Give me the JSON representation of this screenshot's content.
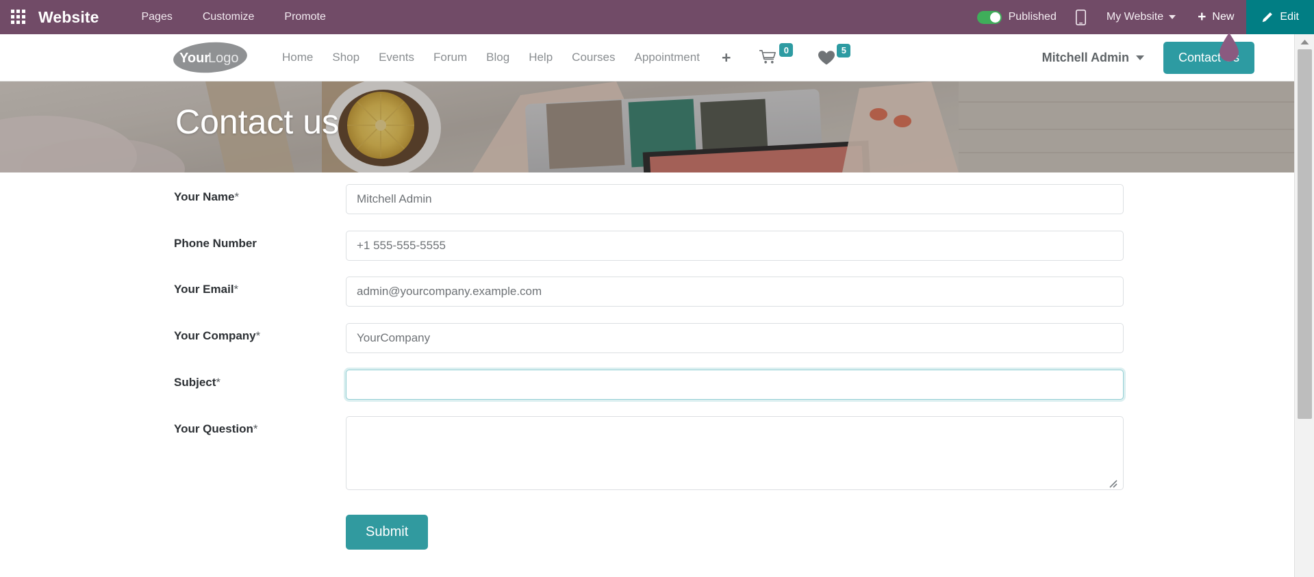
{
  "backend": {
    "apps_icon": "apps-grid-icon",
    "brand": "Website",
    "menu": [
      {
        "label": "Pages"
      },
      {
        "label": "Customize"
      },
      {
        "label": "Promote"
      }
    ],
    "published_toggle": {
      "label": "Published",
      "state": "on",
      "color": "#3fae5a"
    },
    "mobile_preview_icon": "mobile-phone-icon",
    "site_selector": "My Website",
    "new_button": "New",
    "edit_button": "Edit",
    "edit_button_color": "#017e84",
    "navbar_color": "#714B67"
  },
  "site_header": {
    "logo_text_bold": "Your",
    "logo_text_light": "Logo",
    "nav": [
      {
        "label": "Home"
      },
      {
        "label": "Shop"
      },
      {
        "label": "Events"
      },
      {
        "label": "Forum"
      },
      {
        "label": "Blog"
      },
      {
        "label": "Help"
      },
      {
        "label": "Courses"
      },
      {
        "label": "Appointment"
      }
    ],
    "add_page_icon": "plus-icon",
    "cart": {
      "icon": "shopping-cart-icon",
      "count": "0"
    },
    "wishlist": {
      "icon": "heart-icon",
      "count": "5"
    },
    "user": "Mitchell Admin",
    "cta_button": "Contact Us",
    "accent_color": "#2d9ba2"
  },
  "hero": {
    "title": "Contact us"
  },
  "form": {
    "fields": [
      {
        "label": "Your Name",
        "required": true,
        "value": "Mitchell Admin",
        "placeholder": "",
        "type": "text",
        "focused": false
      },
      {
        "label": "Phone Number",
        "required": false,
        "value": "+1 555-555-5555",
        "placeholder": "",
        "type": "text",
        "focused": false
      },
      {
        "label": "Your Email",
        "required": true,
        "value": "admin@yourcompany.example.com",
        "placeholder": "",
        "type": "text",
        "focused": false
      },
      {
        "label": "Your Company",
        "required": true,
        "value": "YourCompany",
        "placeholder": "",
        "type": "text",
        "focused": false
      },
      {
        "label": "Subject",
        "required": true,
        "value": "",
        "placeholder": "",
        "type": "text",
        "focused": true
      },
      {
        "label": "Your Question",
        "required": true,
        "value": "",
        "placeholder": "",
        "type": "textarea",
        "focused": false
      }
    ],
    "required_marker": "*",
    "submit_label": "Submit",
    "submit_color": "#319a9f"
  },
  "scrollbar": {
    "up_arrow_icon": "chevron-up-icon",
    "position": "top"
  }
}
